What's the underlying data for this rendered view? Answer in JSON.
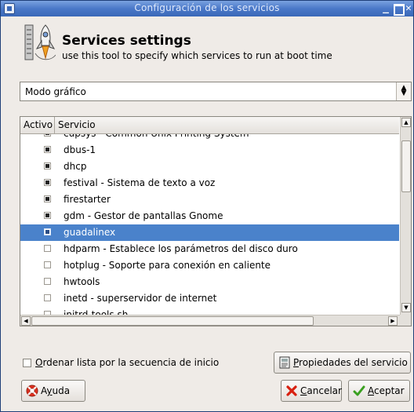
{
  "window": {
    "title": "Configuración de los servicios"
  },
  "header": {
    "title": "Services settings",
    "subtitle": "use this tool to specify which services to run at boot time"
  },
  "mode_select": {
    "value": "Modo gráfico"
  },
  "table": {
    "columns": [
      "Activo",
      "Servicio"
    ],
    "rows": [
      {
        "checked": true,
        "name": "cupsys - Common Unix Printing System",
        "selected": false
      },
      {
        "checked": true,
        "name": "dbus-1",
        "selected": false
      },
      {
        "checked": true,
        "name": "dhcp",
        "selected": false
      },
      {
        "checked": true,
        "name": "festival - Sistema de texto a voz",
        "selected": false
      },
      {
        "checked": true,
        "name": "firestarter",
        "selected": false
      },
      {
        "checked": true,
        "name": "gdm - Gestor de pantallas Gnome",
        "selected": false
      },
      {
        "checked": true,
        "name": "guadalinex",
        "selected": true
      },
      {
        "checked": false,
        "name": "hdparm - Establece los parámetros del disco duro",
        "selected": false
      },
      {
        "checked": false,
        "name": "hotplug - Soporte para conexión en caliente",
        "selected": false
      },
      {
        "checked": false,
        "name": "hwtools",
        "selected": false
      },
      {
        "checked": false,
        "name": "inetd - superservidor de internet",
        "selected": false
      },
      {
        "checked": false,
        "name": "initrd-tools.sh",
        "selected": false
      }
    ]
  },
  "sort_option": {
    "mnemonic": "O",
    "rest": "rdenar lista por la secuencia de inicio",
    "checked": false
  },
  "buttons": {
    "properties": {
      "mnemonic": "P",
      "rest": "ropiedades del servicio"
    },
    "help": {
      "prefix": "A",
      "mnemonic": "y",
      "rest": "uda"
    },
    "cancel": {
      "mnemonic": "C",
      "rest": "ancelar"
    },
    "ok": {
      "mnemonic": "A",
      "rest": "ceptar"
    }
  },
  "colors": {
    "titlebar": "#4a78c8",
    "selection": "#4a82cb",
    "background": "#efebe7"
  }
}
